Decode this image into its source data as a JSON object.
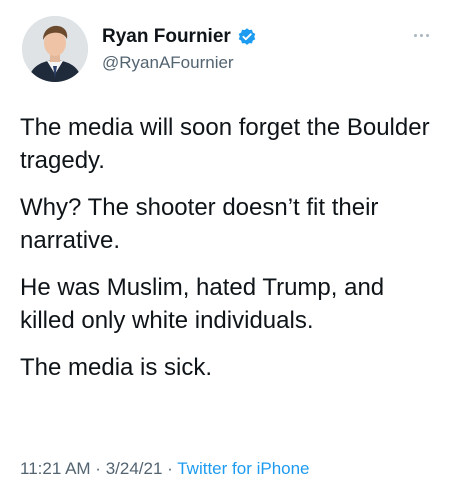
{
  "author": {
    "display_name": "Ryan Fournier",
    "handle": "@RyanAFournier",
    "verified": true,
    "verified_color": "#1d9bf0"
  },
  "tweet": {
    "paragraphs": [
      "The media will soon forget the Boulder tragedy.",
      "Why? The shooter doesn’t fit their narrative.",
      "He was Muslim, hated Trump, and killed only white individuals.",
      "The media is sick."
    ],
    "time": "11:21 AM",
    "date": "3/24/21",
    "separator": " · ",
    "source": "Twitter for iPhone",
    "source_color": "#1d9bf0"
  },
  "icons": {
    "avatar": "profile-photo",
    "verified": "verified-badge-icon",
    "more": "more-options-icon"
  }
}
